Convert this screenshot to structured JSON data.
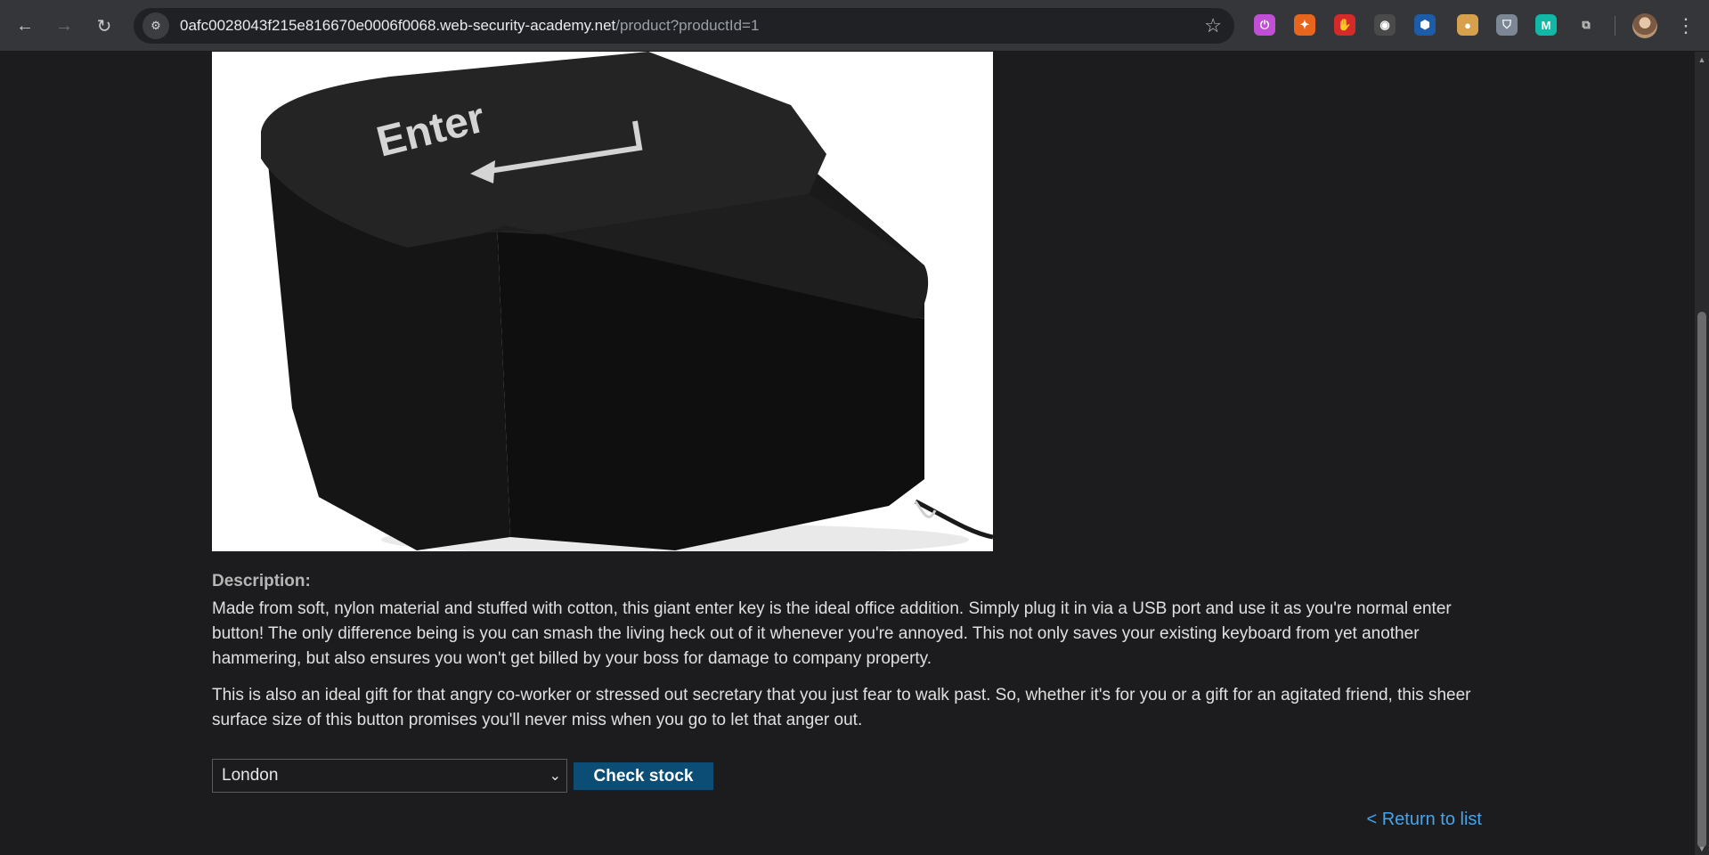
{
  "browser": {
    "url_host": "0afc0028043f215e816670e0006f0068.web-security-academy.net",
    "url_path": "/product?productId=1",
    "extensions": [
      {
        "name": "power-extension-icon",
        "color": "#c04fd6",
        "glyph": "⏻"
      },
      {
        "name": "burp-extension-icon",
        "color": "#e8651d",
        "glyph": "✦"
      },
      {
        "name": "hand-stop-extension-icon",
        "color": "#d42a2a",
        "glyph": "✋"
      },
      {
        "name": "spy-glasses-extension-icon",
        "color": "#4a4a4a",
        "glyph": "◉"
      },
      {
        "name": "hexagon-extension-icon",
        "color": "#1d5ca8",
        "glyph": "⬢"
      },
      {
        "name": "cookie-extension-icon",
        "color": "#d6a04d",
        "glyph": "●"
      },
      {
        "name": "shield-extension-icon",
        "color": "#7b8794",
        "glyph": "⛉"
      },
      {
        "name": "wappalyzer-extension-icon",
        "color": "#12b8a6",
        "glyph": "M"
      },
      {
        "name": "puzzle-extensions-icon",
        "color": "transparent",
        "glyph": "⧉"
      }
    ]
  },
  "product": {
    "image_key_label": "Enter"
  },
  "description": {
    "title": "Description:",
    "paragraph1": "Made from soft, nylon material and stuffed with cotton, this giant enter key is the ideal office addition. Simply plug it in via a USB port and use it as you're normal enter button! The only difference being is you can smash the living heck out of it whenever you're annoyed. This not only saves your existing keyboard from yet another hammering, but also ensures you won't get billed by your boss for damage to company property.",
    "paragraph2": "This is also an ideal gift for that angry co-worker or stressed out secretary that you just fear to walk past. So, whether it's for you or a gift for an agitated friend, this sheer surface size of this button promises you'll never miss when you go to let that anger out."
  },
  "stock": {
    "selected_store": "London",
    "check_label": "Check stock"
  },
  "links": {
    "return_label": "< Return to list"
  },
  "colors": {
    "page_bg": "#1c1c1e",
    "button_bg": "#0b4d74",
    "link": "#46a4ec"
  }
}
